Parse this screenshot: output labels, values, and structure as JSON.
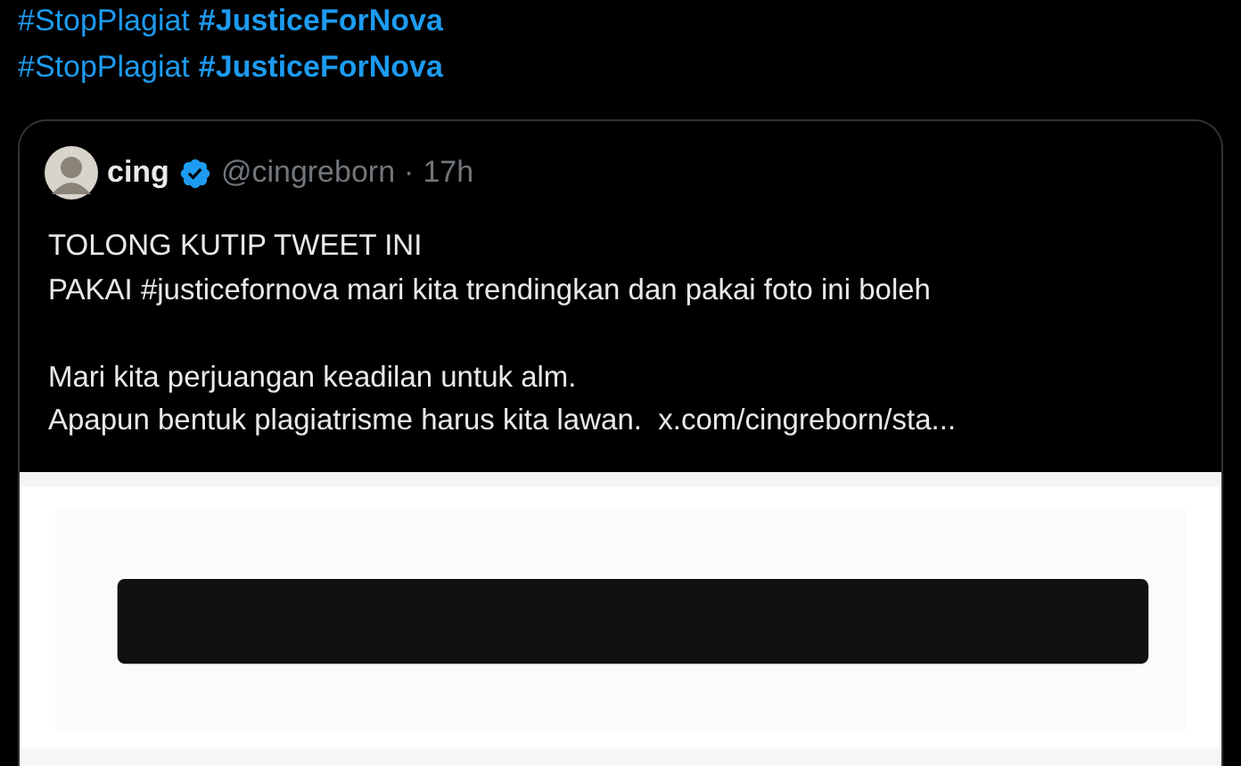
{
  "hashtag_lines": [
    {
      "parts": [
        {
          "text": "#StopPlagiat",
          "bold": false
        },
        {
          "text": "#JusticeForNova",
          "bold": true
        }
      ]
    },
    {
      "parts": [
        {
          "text": "#StopPlagiat",
          "bold": false
        },
        {
          "text": "#JusticeForNova",
          "bold": true
        }
      ]
    }
  ],
  "quoted_tweet": {
    "author": {
      "name": "cing",
      "verified": true,
      "handle": "@cingreborn",
      "separator": "·",
      "time": "17h"
    },
    "lines": [
      {
        "text": "TOLONG KUTIP TWEET INI"
      },
      {
        "text": "PAKAI #justicefornova mari kita trendingkan dan pakai foto ini boleh"
      },
      {
        "text": "Mari kita perjuangan keadilan untuk alm.",
        "gap_before": true
      },
      {
        "text": "Apapun bentuk plagiatrisme harus kita lawan.",
        "link": "x.com/cingreborn/sta..."
      }
    ]
  }
}
